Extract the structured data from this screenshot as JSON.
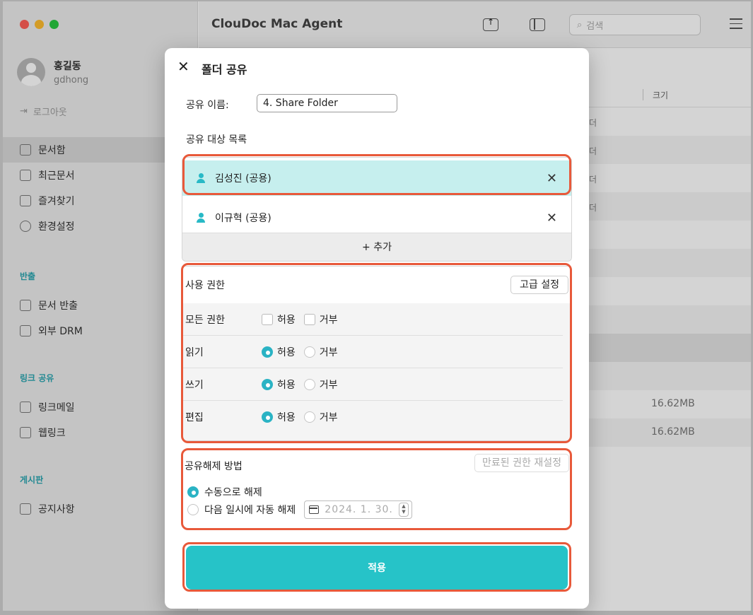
{
  "app": {
    "title": "ClouDoc Mac Agent",
    "search_placeholder": "검색"
  },
  "user": {
    "name": "홍길동",
    "id": "gdhong",
    "logout": "로그아웃"
  },
  "sidebar": {
    "main": [
      {
        "label": "문서함",
        "active": true
      },
      {
        "label": "최근문서"
      },
      {
        "label": "즐겨찾기"
      },
      {
        "label": "환경설정"
      }
    ],
    "export_section": "반출",
    "export_items": [
      {
        "label": "문서 반출"
      },
      {
        "label": "외부 DRM"
      }
    ],
    "link_section": "링크 공유",
    "link_items": [
      {
        "label": "링크메일"
      },
      {
        "label": "웹링크"
      }
    ],
    "board_section": "게시판",
    "board_items": [
      {
        "label": "공지사항"
      }
    ]
  },
  "list": {
    "size_header": "크기",
    "rows": [
      {
        "type": "더",
        "size": ""
      },
      {
        "type": "더",
        "size": ""
      },
      {
        "type": "더",
        "size": ""
      },
      {
        "type": "더",
        "size": ""
      },
      {
        "type": "",
        "size": ""
      },
      {
        "type": "",
        "size": ""
      },
      {
        "type": "",
        "size": ""
      },
      {
        "type": "",
        "size": ""
      },
      {
        "type": "",
        "size": ""
      },
      {
        "type": "",
        "size": ""
      },
      {
        "type": "",
        "size": "16.62MB"
      },
      {
        "type": "",
        "size": "16.62MB"
      }
    ]
  },
  "modal": {
    "title": "폴더 공유",
    "share_name_label": "공유 이름:",
    "share_name_value": "4. Share Folder",
    "targets_label": "공유 대상 목록",
    "targets": [
      {
        "name": "김성진 (공용)"
      },
      {
        "name": "이규혁 (공용)"
      }
    ],
    "remove_symbol": "✕",
    "add_label": "+ 추가",
    "permissions": {
      "header": "사용 권한",
      "advanced_button": "고급 설정",
      "allow": "허용",
      "deny": "거부",
      "rows": [
        {
          "label": "모든 권한",
          "kind": "checkbox",
          "allow": false,
          "deny": false
        },
        {
          "label": "읽기",
          "kind": "radio",
          "value": "허용"
        },
        {
          "label": "쓰기",
          "kind": "radio",
          "value": "허용"
        },
        {
          "label": "편집",
          "kind": "radio",
          "value": "허용"
        }
      ]
    },
    "release": {
      "header": "공유해제 방법",
      "reset_button": "만료된 권한 재설정",
      "manual_label": "수동으로 해제",
      "auto_label": "다음 일시에 자동 해제",
      "selected": "manual",
      "date": "2024.  1. 30."
    },
    "apply_button": "적용"
  },
  "colors": {
    "accent": "#26c3c8",
    "highlight": "#e8593a",
    "selected_row": "#c6efee"
  }
}
